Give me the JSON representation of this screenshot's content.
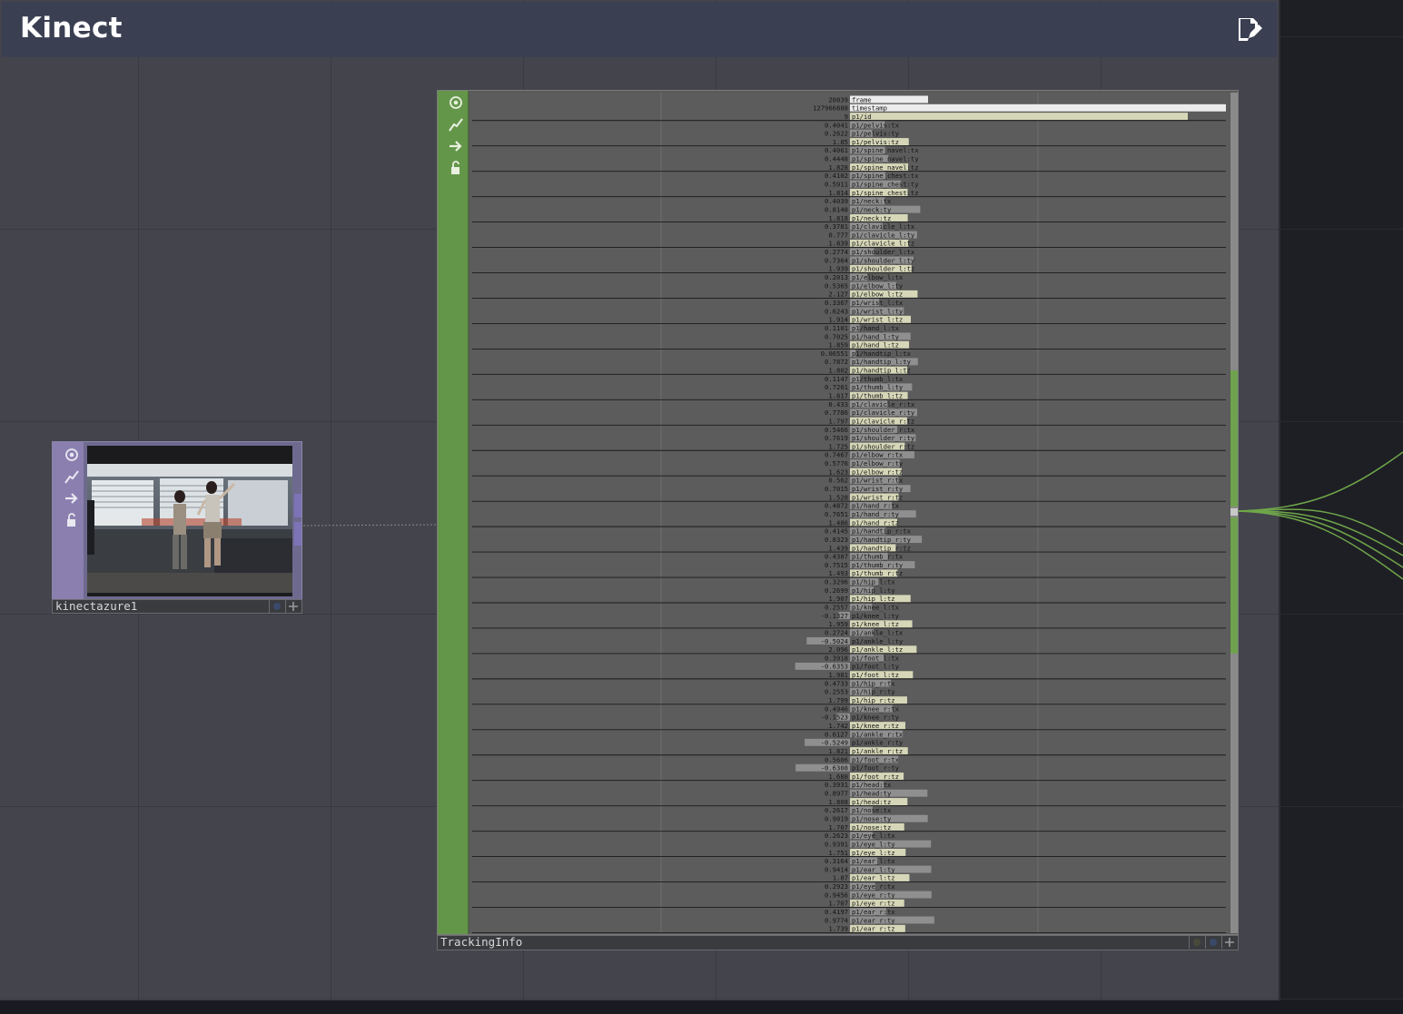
{
  "header": {
    "title": "Kinect",
    "edit_icon": "edit-icon"
  },
  "nodes": {
    "kinect": {
      "label": "kinectazure1",
      "color": "#8b7fb0"
    },
    "tracking": {
      "label": "TrackingInfo",
      "color": "#64964a"
    }
  },
  "side_buttons": [
    "eye-icon",
    "graph-icon",
    "arrow-icon",
    "lock-icon"
  ],
  "channels": [
    {
      "v": "20839",
      "n": "frame"
    },
    {
      "v": "127966888",
      "n": "timestamp"
    },
    {
      "v": "9",
      "n": "p1/id"
    },
    {
      "v": "0.4041",
      "n": "p1/pelvis:tx"
    },
    {
      "v": "0.2622",
      "n": "p1/pelvis:ty"
    },
    {
      "v": "1.85",
      "n": "p1/pelvis:tz"
    },
    {
      "v": "0.4061",
      "n": "p1/spine_navel:tx"
    },
    {
      "v": "0.4448",
      "n": "p1/spine_navel:ty"
    },
    {
      "v": "1.828",
      "n": "p1/spine_navel:tz"
    },
    {
      "v": "0.4102",
      "n": "p1/spine_chest:tx"
    },
    {
      "v": "0.5911",
      "n": "p1/spine_chest:ty"
    },
    {
      "v": "1.814",
      "n": "p1/spine_chest:tz"
    },
    {
      "v": "0.4039",
      "n": "p1/neck:tx"
    },
    {
      "v": "0.8148",
      "n": "p1/neck:ty"
    },
    {
      "v": "1.818",
      "n": "p1/neck:tz"
    },
    {
      "v": "0.3781",
      "n": "p1/clavicle_l:tx"
    },
    {
      "v": "0.777",
      "n": "p1/clavicle_l:ty"
    },
    {
      "v": "1.839",
      "n": "p1/clavicle_l:tz"
    },
    {
      "v": "0.2774",
      "n": "p1/shoulder_l:tx"
    },
    {
      "v": "0.7364",
      "n": "p1/shoulder_l:ty"
    },
    {
      "v": "1.939",
      "n": "p1/shoulder_l:tz"
    },
    {
      "v": "0.2013",
      "n": "p1/elbow_l:tx"
    },
    {
      "v": "0.5365",
      "n": "p1/elbow_l:ty"
    },
    {
      "v": "2.127",
      "n": "p1/elbow_l:tz"
    },
    {
      "v": "0.3367",
      "n": "p1/wrist_l:tx"
    },
    {
      "v": "0.6243",
      "n": "p1/wrist_l:ty"
    },
    {
      "v": "1.914",
      "n": "p1/wrist_l:tz"
    },
    {
      "v": "0.1101",
      "n": "p1/hand_l:tx"
    },
    {
      "v": "0.7025",
      "n": "p1/hand_l:ty"
    },
    {
      "v": "1.859",
      "n": "p1/hand_l:tz"
    },
    {
      "v": "0.06551",
      "n": "p1/handtip_l:tx"
    },
    {
      "v": "0.7872",
      "n": "p1/handtip_l:ty"
    },
    {
      "v": "1.802",
      "n": "p1/handtip_l:tz"
    },
    {
      "v": "0.1147",
      "n": "p1/thumb_l:tx"
    },
    {
      "v": "0.7201",
      "n": "p1/thumb_l:ty"
    },
    {
      "v": "1.817",
      "n": "p1/thumb_l:tz"
    },
    {
      "v": "0.433",
      "n": "p1/clavicle_r:tx"
    },
    {
      "v": "0.7786",
      "n": "p1/clavicle_r:ty"
    },
    {
      "v": "1.797",
      "n": "p1/clavicle_r:tz"
    },
    {
      "v": "0.5466",
      "n": "p1/shoulder_r:tx"
    },
    {
      "v": "0.7619",
      "n": "p1/shoulder_r:ty"
    },
    {
      "v": "1.725",
      "n": "p1/shoulder_r:tz"
    },
    {
      "v": "0.7467",
      "n": "p1/elbow_r:tx"
    },
    {
      "v": "0.5776",
      "n": "p1/elbow_r:ty"
    },
    {
      "v": "1.623",
      "n": "p1/elbow_r:tz"
    },
    {
      "v": "0.562",
      "n": "p1/wrist_r:tx"
    },
    {
      "v": "0.7015",
      "n": "p1/wrist_r:ty"
    },
    {
      "v": "1.528",
      "n": "p1/wrist_r:tz"
    },
    {
      "v": "0.4872",
      "n": "p1/hand_r:tx"
    },
    {
      "v": "0.7651",
      "n": "p1/hand_r:ty"
    },
    {
      "v": "1.486",
      "n": "p1/hand_r:tz"
    },
    {
      "v": "0.4145",
      "n": "p1/handtip_r:tx"
    },
    {
      "v": "0.8323",
      "n": "p1/handtip_r:ty"
    },
    {
      "v": "1.439",
      "n": "p1/handtip_r:tz"
    },
    {
      "v": "0.4387",
      "n": "p1/thumb_r:tx"
    },
    {
      "v": "0.7515",
      "n": "p1/thumb_r:ty"
    },
    {
      "v": "1.493",
      "n": "p1/thumb_r:tz"
    },
    {
      "v": "0.3296",
      "n": "p1/hip_l:tx"
    },
    {
      "v": "0.2699",
      "n": "p1/hip_l:ty"
    },
    {
      "v": "1.907",
      "n": "p1/hip_l:tz"
    },
    {
      "v": "0.2557",
      "n": "p1/knee_l:tx"
    },
    {
      "v": "-0.1327",
      "n": "p1/knee_l:ty"
    },
    {
      "v": "1.959",
      "n": "p1/knee_l:tz"
    },
    {
      "v": "0.2724",
      "n": "p1/ankle_l:tx"
    },
    {
      "v": "-0.5024",
      "n": "p1/ankle_l:ty"
    },
    {
      "v": "2.096",
      "n": "p1/ankle_l:tz"
    },
    {
      "v": "0.3918",
      "n": "p1/foot_l:tx"
    },
    {
      "v": "-0.6353",
      "n": "p1/foot_l:ty"
    },
    {
      "v": "1.981",
      "n": "p1/foot_l:tz"
    },
    {
      "v": "0.4733",
      "n": "p1/hip_r:tx"
    },
    {
      "v": "0.2553",
      "n": "p1/hip_r:ty"
    },
    {
      "v": "1.799",
      "n": "p1/hip_r:tz"
    },
    {
      "v": "0.4946",
      "n": "p1/knee_r:tx"
    },
    {
      "v": "-0.1523",
      "n": "p1/knee_r:ty"
    },
    {
      "v": "1.742",
      "n": "p1/knee_r:tz"
    },
    {
      "v": "0.6127",
      "n": "p1/ankle_r:tx"
    },
    {
      "v": "-0.5249",
      "n": "p1/ankle_r:ty"
    },
    {
      "v": "1.821",
      "n": "p1/ankle_r:tz"
    },
    {
      "v": "0.5606",
      "n": "p1/foot_r:tx"
    },
    {
      "v": "-0.6308",
      "n": "p1/foot_r:ty"
    },
    {
      "v": "1.688",
      "n": "p1/foot_r:tz"
    },
    {
      "v": "0.3931",
      "n": "p1/head:tx"
    },
    {
      "v": "0.8977",
      "n": "p1/head:ty"
    },
    {
      "v": "1.808",
      "n": "p1/head:tz"
    },
    {
      "v": "0.2617",
      "n": "p1/nose:tx"
    },
    {
      "v": "0.9019",
      "n": "p1/nose:ty"
    },
    {
      "v": "1.707",
      "n": "p1/nose:tz"
    },
    {
      "v": "0.2623",
      "n": "p1/eye_l:tx"
    },
    {
      "v": "0.9391",
      "n": "p1/eye_l:ty"
    },
    {
      "v": "1.751",
      "n": "p1/eye_l:tz"
    },
    {
      "v": "0.3164",
      "n": "p1/ear_l:tx"
    },
    {
      "v": "0.9414",
      "n": "p1/ear_l:ty"
    },
    {
      "v": "1.87",
      "n": "p1/ear_l:tz"
    },
    {
      "v": "0.2923",
      "n": "p1/eye_r:tx"
    },
    {
      "v": "0.9456",
      "n": "p1/eye_r:ty"
    },
    {
      "v": "1.707",
      "n": "p1/eye_r:tz"
    },
    {
      "v": "0.4197",
      "n": "p1/ear_r:tx"
    },
    {
      "v": "0.9774",
      "n": "p1/ear_r:ty"
    },
    {
      "v": "1.739",
      "n": "p1/ear_r:tz"
    }
  ]
}
